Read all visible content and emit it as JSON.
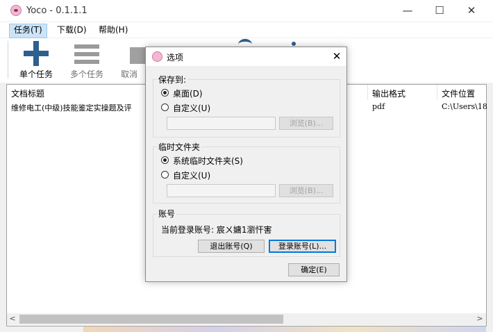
{
  "window": {
    "title": "Yoco - 0.1.1.1",
    "minimize": "—",
    "maximize": "☐",
    "close": "✕"
  },
  "menu": [
    {
      "label": "任务(T)"
    },
    {
      "label": "下载(D)"
    },
    {
      "label": "帮助(H)"
    }
  ],
  "toolbar": {
    "single_task": "单个任务",
    "multi_task": "多个任务",
    "cancel_task": "取消任"
  },
  "table": {
    "columns": [
      "文档标题",
      "输出格式",
      "文件位置"
    ],
    "rows": [
      {
        "title": "维修电工(中级)技能鉴定实操题及评",
        "format": "pdf",
        "location": "C:\\Users\\18"
      }
    ]
  },
  "scroll": {
    "left": "<",
    "right": ">"
  },
  "dialog": {
    "title": "选项",
    "close": "✕",
    "save_to": {
      "label": "保存到:",
      "desktop": "桌面(D)",
      "custom": "自定义(U)",
      "path": "",
      "browse": "浏览(B)..."
    },
    "temp_folder": {
      "label": "临时文件夹",
      "system": "系统临时文件夹(S)",
      "custom": "自定义(U)",
      "path": "",
      "browse": "浏览(B)..."
    },
    "account": {
      "label": "账号",
      "current": "当前登录账号: 宸ㄨ嫞1瀏忓害",
      "logout": "退出账号(Q)",
      "login": "登录账号(L)..."
    },
    "ok": "确定(E)"
  },
  "colors": {
    "accent": "#0078d7",
    "menu_highlight": "#cce4f7",
    "plus_icon": "#2d5f8f"
  }
}
